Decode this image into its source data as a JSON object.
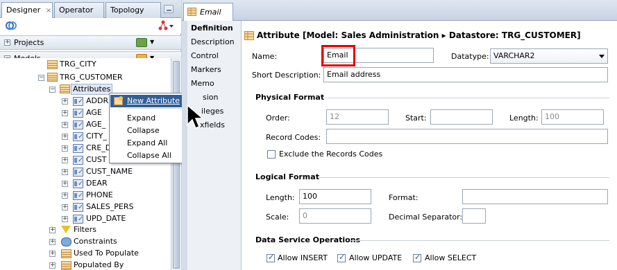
{
  "left": {
    "tabs": [
      {
        "label": "Designer",
        "close": "×"
      },
      {
        "label": "Operator"
      },
      {
        "label": "Topology"
      }
    ],
    "sections": {
      "projects": "Projects",
      "models": "Models"
    },
    "tree": {
      "cut_node": "TRG_CITY",
      "datastore": "TRG_CUSTOMER",
      "attributes_folder": "Attributes",
      "attributes": [
        "ADDR",
        "AGE",
        "AGE_",
        "CITY_",
        "CRE_D",
        "CUST",
        "CUST_NAME",
        "DEAR",
        "PHONE",
        "SALES_PERS",
        "UPD_DATE"
      ],
      "folders": [
        "Filters",
        "Constraints",
        "Used To Populate",
        "Populated By"
      ]
    },
    "context_menu": {
      "items": [
        "New Attribute",
        "Expand",
        "Collapse",
        "Expand All",
        "Collapse All"
      ],
      "highlighted": "New Attribute"
    }
  },
  "editor": {
    "tab_label": "Email",
    "nav": {
      "items": [
        "Definition",
        "Description",
        "Control",
        "Markers",
        "Memo",
        "Version",
        "Privileges",
        "Flexfields"
      ],
      "visible_text": [
        "Definition",
        "Description",
        "Control",
        "Markers",
        "Memo",
        "sion",
        "ileges",
        "xfields"
      ],
      "active": "Definition"
    },
    "header": "Attribute [Model: Sales Administration ▸ Datastore: TRG_CUSTOMER]",
    "name_label": "Name:",
    "name_value": "Email",
    "datatype_label": "Datatype:",
    "datatype_value": "VARCHAR2",
    "short_desc_label": "Short Description:",
    "short_desc_value": "Email address",
    "physical": {
      "title": "Physical Format",
      "order_label": "Order:",
      "order_value": "12",
      "start_label": "Start:",
      "start_value": "",
      "length_label": "Length:",
      "length_value": "100",
      "record_codes_label": "Record Codes:",
      "record_codes_value": "",
      "exclude_label": "Exclude the Records Codes",
      "exclude_checked": false
    },
    "logical": {
      "title": "Logical Format",
      "length_label": "Length:",
      "length_value": "100",
      "format_label": "Format:",
      "format_value": "",
      "scale_label": "Scale:",
      "scale_value": "0",
      "decimal_label": "Decimal Separator:",
      "decimal_value": ""
    },
    "dso": {
      "title": "Data Service Operations",
      "insert_label": "Allow INSERT",
      "insert_checked": true,
      "update_label": "Allow UPDATE",
      "update_checked": true,
      "select_label": "Allow SELECT",
      "select_checked": true
    }
  },
  "colors": {
    "highlight_box": "#e30000",
    "menu_highlight": "#315f98"
  }
}
